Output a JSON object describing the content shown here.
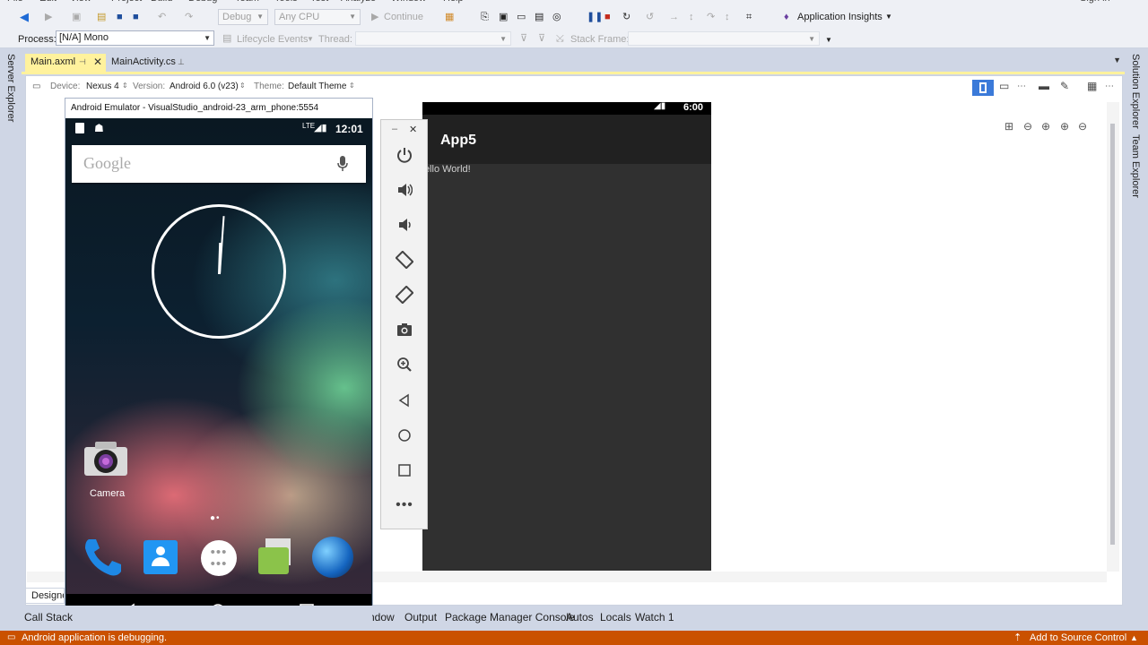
{
  "menu": {
    "items": [
      "File",
      "Edit",
      "View",
      "Project",
      "Build",
      "Debug",
      "Team",
      "Tools",
      "Test",
      "Analyze",
      "Window",
      "Help"
    ],
    "signin": "Sign in"
  },
  "toolbar": {
    "config": "Debug",
    "platform": "Any CPU",
    "continue": "Continue",
    "app_insights": "Application Insights"
  },
  "debug_location": {
    "process_label": "Process:",
    "process_value": "[N/A] Mono",
    "lifecycle": "Lifecycle Events",
    "thread_label": "Thread:",
    "stack_frame_label": "Stack Frame:"
  },
  "side_panels": {
    "left": "Server Explorer",
    "right_1": "Solution Explorer",
    "right_2": "Team Explorer"
  },
  "doc_tabs": [
    {
      "label": "Main.axml",
      "active": true
    },
    {
      "label": "MainActivity.cs",
      "active": false
    }
  ],
  "designer": {
    "device_label": "Device:",
    "device_value": "Nexus 4",
    "version_label": "Version:",
    "version_value": "Android 6.0 (v23)",
    "theme_label": "Theme:",
    "theme_value": "Default Theme",
    "preview_time": "6:00",
    "preview_app_title": "App5",
    "preview_text": "Hello World!",
    "designer_tab": "Designer"
  },
  "emulator": {
    "title": "Android Emulator - VisualStudio_android-23_arm_phone:5554",
    "time": "12:01",
    "network": "LTE",
    "search_logo": "Google",
    "camera_label": "Camera",
    "tools": [
      "power-icon",
      "volume-up-icon",
      "volume-down-icon",
      "rotate-left-icon",
      "rotate-right-icon",
      "camera-icon",
      "zoom-icon",
      "back-icon",
      "home-icon",
      "recents-icon",
      "more-icon"
    ]
  },
  "bottom_tabs": [
    "Call Stack",
    "Window",
    "Output",
    "Package Manager Console",
    "Autos",
    "Locals",
    "Watch 1"
  ],
  "status": {
    "message": "Android application is debugging.",
    "source_control": "Add to Source Control"
  },
  "colors": {
    "accent": "#ca5100",
    "active_tab": "#fff29d",
    "chrome": "#cfd6e5"
  }
}
